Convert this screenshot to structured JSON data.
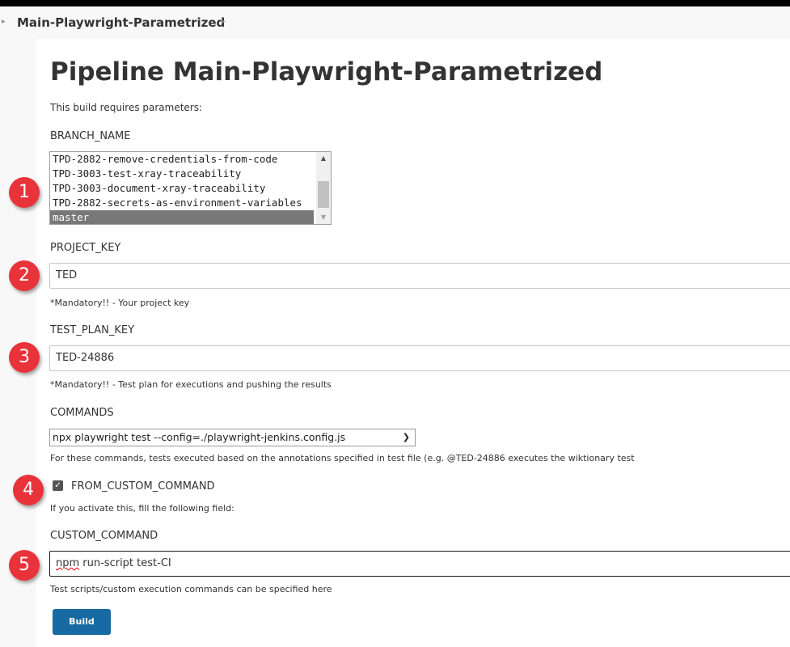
{
  "breadcrumb": {
    "job_name": "Main-Playwright-Parametrized"
  },
  "page": {
    "title": "Pipeline Main-Playwright-Parametrized",
    "subtitle": "This build requires parameters:"
  },
  "params": {
    "branch_name": {
      "label": "BRANCH_NAME",
      "options": [
        "TPD-2882-remove-credentials-from-code",
        "TPD-3003-test-xray-traceability",
        "TPD-3003-document-xray-traceability",
        "TPD-2882-secrets-as-environment-variables",
        "master"
      ],
      "selected": "master"
    },
    "project_key": {
      "label": "PROJECT_KEY",
      "value": "TED",
      "help": "*Mandatory!! - Your project key"
    },
    "test_plan_key": {
      "label": "TEST_PLAN_KEY",
      "value": "TED-24886",
      "help": "*Mandatory!! - Test plan for executions and pushing the results"
    },
    "commands": {
      "label": "COMMANDS",
      "selected": "npx playwright test --config=./playwright-jenkins.config.js",
      "help": "For these commands, tests executed based on the annotations specified in test file (e.g. @TED-24886 executes the wiktionary test"
    },
    "from_custom_command": {
      "label": "FROM_CUSTOM_COMMAND",
      "checked": true,
      "help": "If you activate this, fill the following field:"
    },
    "custom_command": {
      "label": "CUSTOM_COMMAND",
      "value_part1": "npm",
      "value_part2": " run-script test-CI",
      "help": "Test scripts/custom execution commands can be specified here"
    }
  },
  "build_button": {
    "label": "Build"
  },
  "markers": [
    "1",
    "2",
    "3",
    "4",
    "5"
  ],
  "colors": {
    "marker": "#e8333a",
    "build_button": "#176ba2",
    "selected_option": "#787878"
  }
}
